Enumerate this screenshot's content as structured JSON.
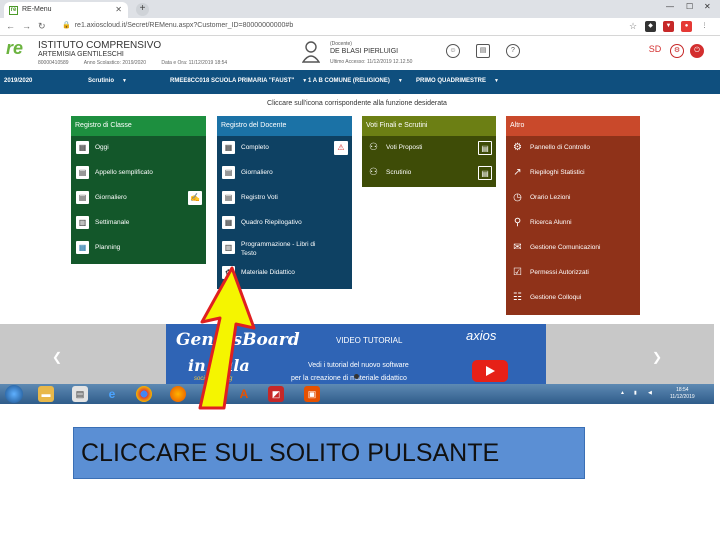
{
  "browser": {
    "tab_title": "RE-Menu",
    "url": "re1.axioscloud.it/Secret/REMenu.aspx?Customer_ID=80000000000#b"
  },
  "header": {
    "logo_text": "re",
    "school_line1": "ISTITUTO COMPRENSIVO",
    "school_line2": "ARTEMISIA GENTILESCHI",
    "school_code": "80000410589",
    "school_year": "Anno Scolastico: 2019/2020",
    "date": "Data e Ora: 11/12/2019 18:54",
    "user_role": "(Docente)",
    "user_name": "DE BLASI PIERLUIGI",
    "last_access": "Ultimo Accesso: 11/12/2019 12.12.50"
  },
  "context": {
    "year": "2019/2020",
    "module": "Scrutinio",
    "school": "RMEE8CC018 SCUOLA PRIMARIA \"FAUST\"",
    "class": "1 A B COMUNE (RELIGIONE)",
    "period": "PRIMO QUADRIMESTRE"
  },
  "instruction": "Cliccare sull'icona corrispondente alla funzione desiderata",
  "panels": {
    "classe": {
      "title": "Registro di Classe",
      "items": [
        "Oggi",
        "Appello semplificato",
        "Giornaliero",
        "Settimanale",
        "Planning"
      ]
    },
    "docente": {
      "title": "Registro del Docente",
      "items": [
        "Completo",
        "Giornaliero",
        "Registro Voti",
        "Quadro Riepilogativo",
        "Programmazione - Libri di Testo",
        "Materiale Didattico"
      ]
    },
    "voti": {
      "title": "Voti Finali e Scrutini",
      "items": [
        "Voti Proposti",
        "Scrutinio"
      ]
    },
    "altro": {
      "title": "Altro",
      "items": [
        "Pannello di Controllo",
        "Riepiloghi Statistici",
        "Orario Lezioni",
        "Ricerca Alunni",
        "Gestione Comunicazioni",
        "Permessi Autorizzati",
        "Gestione Colloqui"
      ]
    }
  },
  "banner": {
    "logo_line1": "GeniusBoard",
    "logo_line2": "in aula",
    "logo_sub": "social learning",
    "title": "VIDEO TUTORIAL",
    "brand": "axios",
    "text1": "Vedi i tutorial del nuovo software",
    "text2": "per la creazione di materiale didattico"
  },
  "taskbar": {
    "time": "18:54",
    "date": "11/12/2019"
  },
  "caption": "CLICCARE SUL SOLITO PULSANTE",
  "colors": {
    "context_bar": "#0f4f7e",
    "panel_classe": "#13572a",
    "panel_docente": "#0e4163",
    "panel_voti": "#3e4c07",
    "panel_altro": "#8f3219",
    "arrow_fill": "#f5f500",
    "arrow_stroke": "#e02020",
    "caption_bg": "#5b8fd4"
  }
}
